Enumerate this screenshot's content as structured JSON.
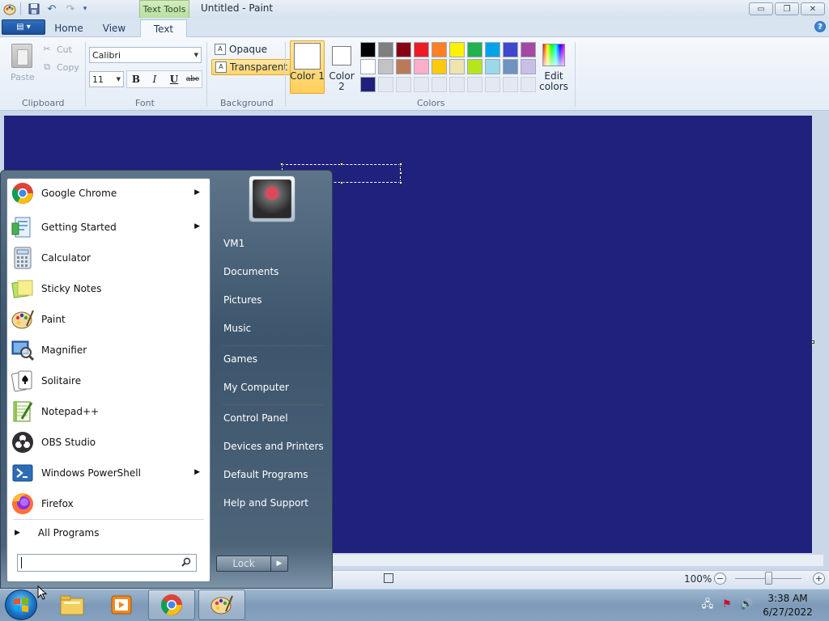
{
  "window": {
    "title": "Untitled - Paint",
    "contextual_tab": "Text Tools",
    "minimize": "▭",
    "restore": "❐",
    "close": "✕"
  },
  "tabs": {
    "home": "Home",
    "view": "View",
    "text": "Text"
  },
  "clipboard": {
    "paste": "Paste",
    "cut": "Cut",
    "copy": "Copy",
    "group": "Clipboard"
  },
  "font": {
    "family": "Calibri",
    "size": "11",
    "bold": "B",
    "italic": "I",
    "underline": "U",
    "strikethrough": "abc",
    "group": "Font"
  },
  "background": {
    "opaque": "Opaque",
    "transparent": "Transparent",
    "group": "Background"
  },
  "colors": {
    "color1_label": "Color 1",
    "color2_label": "Color 2",
    "edit_colors_label": "Edit colors",
    "group": "Colors",
    "color1": "#ffffff",
    "color2": "#ffffff",
    "palette": [
      [
        "#000000",
        "#7f7f7f",
        "#880015",
        "#ed1c24",
        "#ff7f27",
        "#fff200",
        "#22b14c",
        "#00a2e8",
        "#3f48cc",
        "#a349a4"
      ],
      [
        "#ffffff",
        "#c3c3c3",
        "#b97a57",
        "#ffaec9",
        "#ffc90e",
        "#efe4b0",
        "#b5e61d",
        "#99d9ea",
        "#7092be",
        "#c8bfe7"
      ],
      [
        "#1f217d",
        "#e4e9f1",
        "#e4e9f1",
        "#e4e9f1",
        "#e4e9f1",
        "#e4e9f1",
        "#e4e9f1",
        "#e4e9f1",
        "#e4e9f1",
        "#e4e9f1"
      ]
    ]
  },
  "canvas": {
    "background_color": "#1f217d"
  },
  "statusbar": {
    "zoom": "100%",
    "zoom_out": "−",
    "zoom_in": "+"
  },
  "start_menu": {
    "programs": [
      {
        "label": "Google Chrome",
        "icon": "chrome-icon",
        "submenu": true
      },
      {
        "label": "Getting Started",
        "icon": "getting-started-icon",
        "submenu": true
      },
      {
        "label": "Calculator",
        "icon": "calculator-icon",
        "submenu": false
      },
      {
        "label": "Sticky Notes",
        "icon": "sticky-notes-icon",
        "submenu": false
      },
      {
        "label": "Paint",
        "icon": "paint-icon",
        "submenu": false
      },
      {
        "label": "Magnifier",
        "icon": "magnifier-icon",
        "submenu": false
      },
      {
        "label": "Solitaire",
        "icon": "solitaire-icon",
        "submenu": false
      },
      {
        "label": "Notepad++",
        "icon": "notepad-plus-plus-icon",
        "submenu": false
      },
      {
        "label": "OBS Studio",
        "icon": "obs-studio-icon",
        "submenu": false
      },
      {
        "label": "Windows PowerShell",
        "icon": "powershell-icon",
        "submenu": true
      },
      {
        "label": "Firefox",
        "icon": "firefox-icon",
        "submenu": false
      }
    ],
    "all_programs": "All Programs",
    "search_value": "",
    "right_links": [
      {
        "label": "VM1"
      },
      {
        "label": "Documents"
      },
      {
        "label": "Pictures"
      },
      {
        "label": "Music"
      },
      {
        "label": "Games"
      },
      {
        "label": "My Computer"
      },
      {
        "label": "Control Panel"
      },
      {
        "label": "Devices and Printers"
      },
      {
        "label": "Default Programs"
      },
      {
        "label": "Help and Support"
      }
    ],
    "lock": "Lock"
  },
  "taskbar": {
    "apps": [
      "windows-explorer-icon",
      "media-player-icon",
      "chrome-icon",
      "paint-icon"
    ],
    "time": "3:38 AM",
    "date": "6/27/2022"
  }
}
